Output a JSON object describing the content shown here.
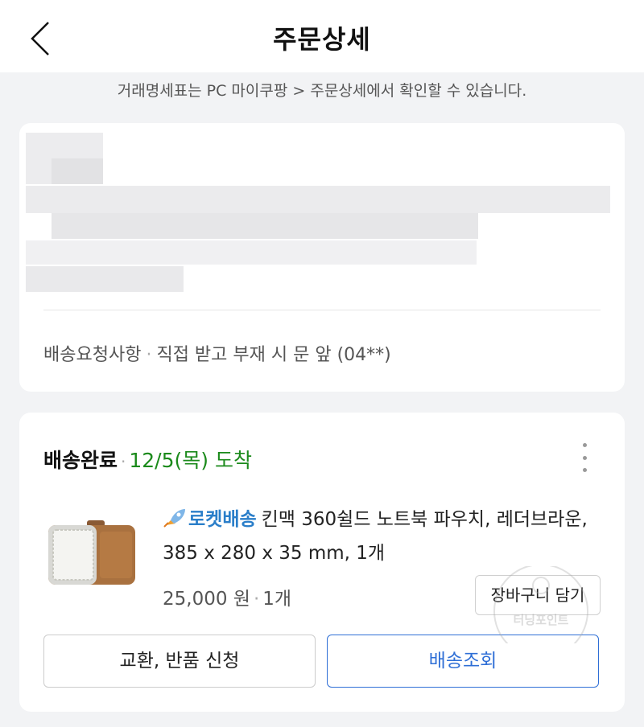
{
  "header": {
    "title": "주문상세"
  },
  "notice": "거래명세표는 PC 마이쿠팡 > 주문상세에서 확인할 수 있습니다.",
  "address_card": {
    "delivery_request_label": "배송요청사항",
    "delivery_request_value": "직접 받고 부재 시 문 앞 (04**)"
  },
  "order": {
    "status": "배송완료",
    "arrival": "12/5(목) 도착",
    "rocket_label": "로켓배송",
    "product_name": "킨맥 360쉴드 노트북 파우치, 레더브라운, 385 x 280 x 35 mm, 1개",
    "price": "25,000 원",
    "quantity": "1개",
    "cart_button": "장바구니 담기",
    "exchange_button": "교환, 반품 신청",
    "track_button": "배송조회"
  },
  "watermark": {
    "text": "터닝포인트"
  },
  "colors": {
    "arrival_green": "#1b8a1b",
    "rocket_blue": "#2a7ec9",
    "track_blue": "#2f6fd6"
  }
}
